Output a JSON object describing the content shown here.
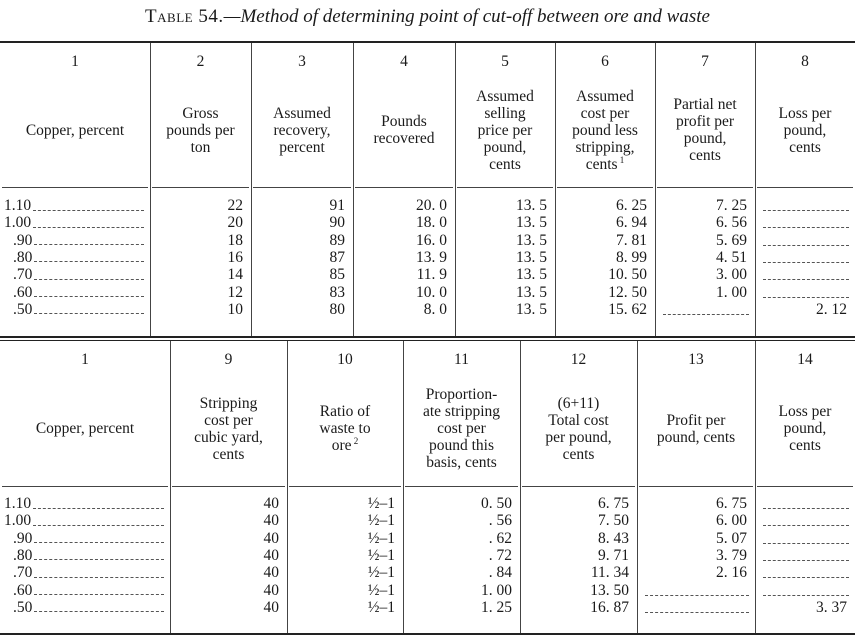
{
  "title": {
    "prefix": "Table 54.",
    "text": "—Method of determining point of cut-off between ore and waste"
  },
  "table_top": {
    "columns": [
      {
        "num": "1",
        "label": [
          "Copper, percent"
        ]
      },
      {
        "num": "2",
        "label": [
          "Gross",
          "pounds per",
          "ton"
        ]
      },
      {
        "num": "3",
        "label": [
          "Assumed",
          "recovery,",
          "percent"
        ]
      },
      {
        "num": "4",
        "label": [
          "Pounds",
          "recovered"
        ]
      },
      {
        "num": "5",
        "label": [
          "Assumed",
          "selling",
          "price per",
          "pound,",
          "cents"
        ]
      },
      {
        "num": "6",
        "label": [
          "Assumed",
          "cost per",
          "pound less",
          "stripping,",
          "cents"
        ],
        "footnote": "1"
      },
      {
        "num": "7",
        "label": [
          "Partial net",
          "profit per",
          "pound,",
          "cents"
        ]
      },
      {
        "num": "8",
        "label": [
          "Loss per",
          "pound,",
          "cents"
        ]
      }
    ],
    "rows": [
      [
        "1.10",
        "22",
        "91",
        "20. 0",
        "13. 5",
        "6. 25",
        "7. 25",
        ""
      ],
      [
        "1.00",
        "20",
        "90",
        "18. 0",
        "13. 5",
        "6. 94",
        "6. 56",
        ""
      ],
      [
        ".90",
        "18",
        "89",
        "16. 0",
        "13. 5",
        "7. 81",
        "5. 69",
        ""
      ],
      [
        ".80",
        "16",
        "87",
        "13. 9",
        "13. 5",
        "8. 99",
        "4. 51",
        ""
      ],
      [
        ".70",
        "14",
        "85",
        "11. 9",
        "13. 5",
        "10. 50",
        "3. 00",
        ""
      ],
      [
        ".60",
        "12",
        "83",
        "10. 0",
        "13. 5",
        "12. 50",
        "1. 00",
        ""
      ],
      [
        ".50",
        "10",
        "80",
        "8. 0",
        "13. 5",
        "15. 62",
        "",
        "2. 12"
      ]
    ]
  },
  "table_bottom": {
    "columns": [
      {
        "num": "1",
        "label": [
          "Copper, percent"
        ]
      },
      {
        "num": "9",
        "label": [
          "Stripping",
          "cost per",
          "cubic yard,",
          "cents"
        ]
      },
      {
        "num": "10",
        "label": [
          "Ratio of",
          "waste to",
          "ore"
        ],
        "footnote": "2"
      },
      {
        "num": "11",
        "label": [
          "Proportion-",
          "ate stripping",
          "cost per",
          "pound this",
          "basis, cents"
        ]
      },
      {
        "num": "12",
        "label": [
          "(6+11)",
          "Total cost",
          "per pound,",
          "cents"
        ]
      },
      {
        "num": "13",
        "label": [
          "Profit per",
          "pound, cents"
        ]
      },
      {
        "num": "14",
        "label": [
          "Loss per",
          "pound,",
          "cents"
        ]
      }
    ],
    "rows": [
      [
        "1.10",
        "40",
        "½–1",
        "0. 50",
        "6. 75",
        "6. 75",
        ""
      ],
      [
        "1.00",
        "40",
        "½–1",
        ". 56",
        "7. 50",
        "6. 00",
        ""
      ],
      [
        ".90",
        "40",
        "½–1",
        ". 62",
        "8. 43",
        "5. 07",
        ""
      ],
      [
        ".80",
        "40",
        "½–1",
        ". 72",
        "9. 71",
        "3. 79",
        ""
      ],
      [
        ".70",
        "40",
        "½–1",
        ". 84",
        "11. 34",
        "2. 16",
        ""
      ],
      [
        ".60",
        "40",
        "½–1",
        "1. 00",
        "13. 50",
        "",
        ""
      ],
      [
        ".50",
        "40",
        "½–1",
        "1. 25",
        "16. 87",
        "",
        "3. 37"
      ]
    ]
  }
}
